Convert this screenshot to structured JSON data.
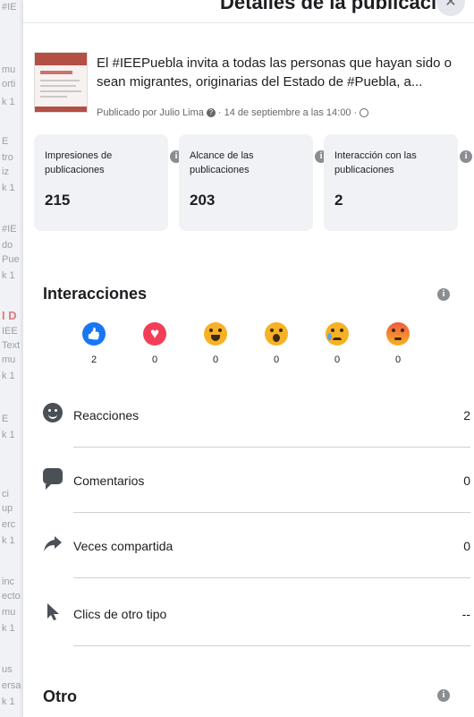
{
  "backdrop": {
    "fragments": [
      "#IE",
      "mu",
      "orti",
      "k 1",
      "E",
      "tro",
      "iz",
      "k 1",
      "#IE",
      "do",
      "Pue",
      "k 1",
      "I D",
      "IEE",
      "Text",
      "mu",
      "k 1",
      "E",
      "k 1",
      "ci",
      "up",
      "erc",
      "k 1",
      "inc",
      "ecto",
      "mu",
      "k 1",
      "us",
      "ersa",
      "k 1"
    ]
  },
  "dialog": {
    "title": "Detalles de la publicación",
    "close_icon": "close-icon"
  },
  "post": {
    "text": "El #IEEPuebla invita a todas las personas que hayan sido o sean migrantes, originarias del Estado de #Puebla, a...",
    "meta": "Publicado por Julio Lima",
    "meta_date": "· 14 de septiembre a las 14:00 ·"
  },
  "stats": [
    {
      "label": "Impresiones de publicaciones",
      "value": "215"
    },
    {
      "label": "Alcance de las publicaciones",
      "value": "203"
    },
    {
      "label": "Interacción con las publicaciones",
      "value": "2"
    }
  ],
  "interactions": {
    "title": "Interacciones",
    "reactions": [
      {
        "name": "like",
        "count": "2"
      },
      {
        "name": "love",
        "count": "0"
      },
      {
        "name": "haha",
        "count": "0"
      },
      {
        "name": "wow",
        "count": "0"
      },
      {
        "name": "sad",
        "count": "0"
      },
      {
        "name": "angry",
        "count": "0"
      }
    ],
    "metrics": [
      {
        "label": "Reacciones",
        "value": "2",
        "icon": "smile-icon"
      },
      {
        "label": "Comentarios",
        "value": "0",
        "icon": "comment-icon"
      },
      {
        "label": "Veces compartida",
        "value": "0",
        "icon": "share-icon"
      },
      {
        "label": "Clics de otro tipo",
        "value": "--",
        "icon": "cursor-icon"
      }
    ]
  },
  "other": {
    "title": "Otro"
  },
  "colors": {
    "like": "#1877f2",
    "love": "#f33e58",
    "emoji": "#f7b125",
    "card_bg": "#f0f2f5"
  }
}
